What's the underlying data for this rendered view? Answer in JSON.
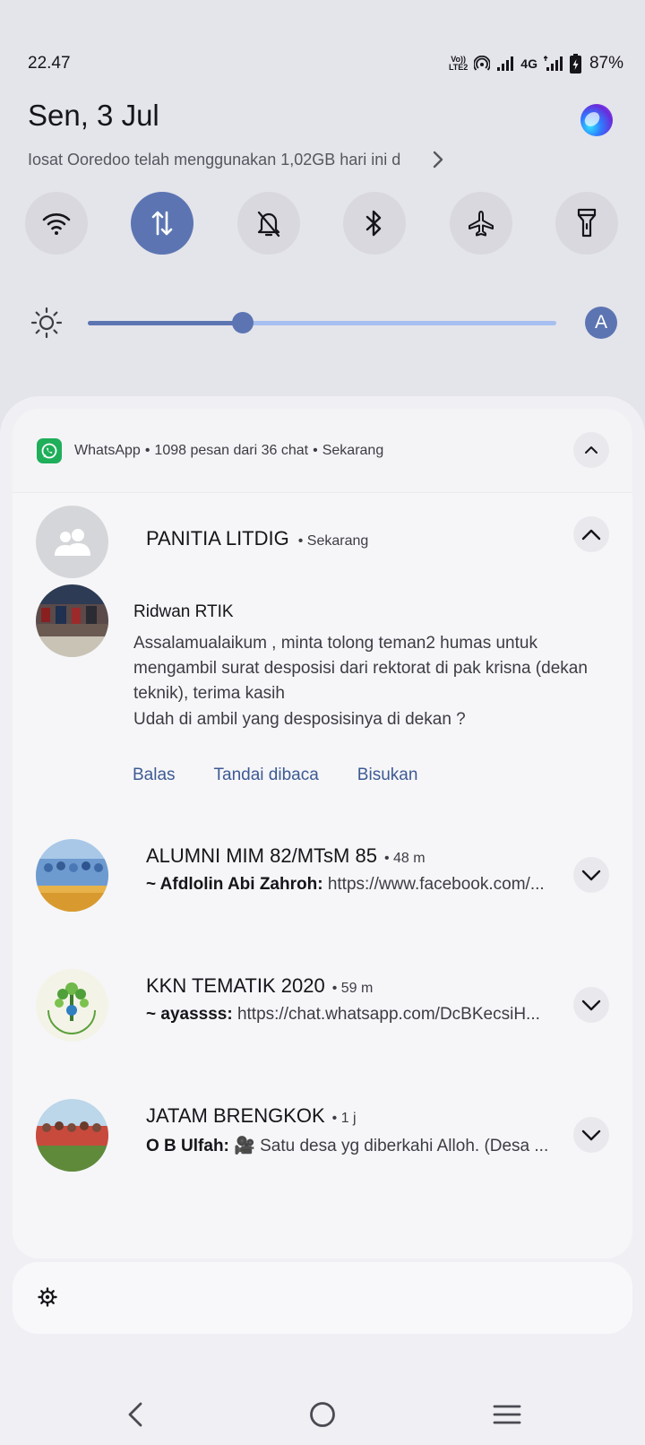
{
  "status_bar": {
    "time": "22.47",
    "volte_top": "Vo))",
    "volte_bottom": "LTE2",
    "network": "4G",
    "battery": "87%"
  },
  "header": {
    "date": "Sen, 3 Jul",
    "data_usage": "Indosat Ooredoo telah menggunakan 1,02GB hari ini d",
    "data_usage_visible": "Iosat Ooredoo telah menggunakan 1,02GB hari ini d"
  },
  "quick_tiles": [
    {
      "icon": "wifi-icon",
      "active": false
    },
    {
      "icon": "mobile-data-icon",
      "active": true
    },
    {
      "icon": "notifications-off-icon",
      "active": false
    },
    {
      "icon": "bluetooth-icon",
      "active": false
    },
    {
      "icon": "airplane-icon",
      "active": false
    },
    {
      "icon": "flashlight-icon",
      "active": false
    }
  ],
  "brightness": {
    "level": 0.33,
    "auto_label": "A"
  },
  "notification": {
    "app": "WhatsApp",
    "summary": "1098 pesan dari 36 chat",
    "time": "Sekarang",
    "expanded": {
      "group": "PANITIA LITDIG",
      "time": "Sekarang",
      "sender": "Ridwan RTIK",
      "message": "Assalamualaikum , minta tolong teman2 humas untuk mengambil surat desposisi dari rektorat di pak krisna (dekan teknik), terima kasih",
      "message2": "Udah di ambil yang desposisinya di dekan ?"
    },
    "actions": [
      "Balas",
      "Tandai dibaca",
      "Bisukan"
    ],
    "conversations": [
      {
        "title": "ALUMNI MIM 82/MTsM 85",
        "time": "48 m",
        "sender": "~ Afdlolin Abi Zahroh:",
        "text": "https://www.facebook.com/..."
      },
      {
        "title": "KKN TEMATIK 2020",
        "time": "59 m",
        "sender": "~ ayassss:",
        "text": "https://chat.whatsapp.com/DcBKecsiH..."
      },
      {
        "title": "JATAM BRENGKOK",
        "time": "1 j",
        "sender": "O B Ulfah:",
        "text": "🎥 Satu desa yg diberkahi Alloh. (Desa ..."
      }
    ]
  },
  "colors": {
    "accent": "#5c75b2",
    "accent_light": "#a6bff0",
    "whatsapp": "#1fae5a",
    "action_text": "#3d5a94"
  }
}
